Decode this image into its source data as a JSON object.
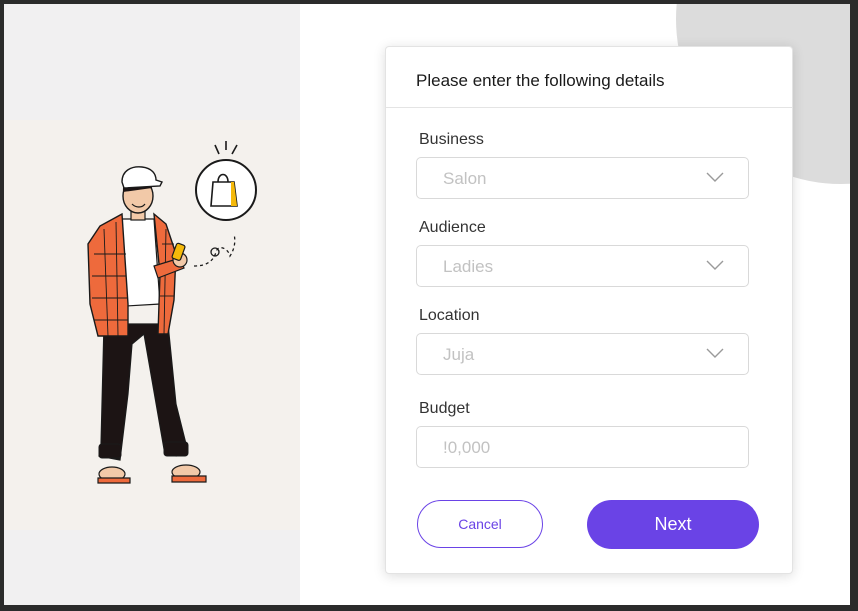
{
  "form": {
    "title": "Please enter the following details",
    "fields": [
      {
        "label": "Business",
        "value": "Salon",
        "type": "dropdown"
      },
      {
        "label": "Audience",
        "value": "Ladies",
        "type": "dropdown"
      },
      {
        "label": "Location",
        "value": "Juja",
        "type": "dropdown"
      },
      {
        "label": "Budget",
        "placeholder": "!0,000",
        "type": "text"
      }
    ],
    "buttons": {
      "cancel_label": "Cancel",
      "next_label": "Next"
    }
  },
  "illustration": {
    "description_icons": [
      "person-icon",
      "smartphone-icon",
      "shopping-bag-icon"
    ]
  },
  "colors": {
    "accent": "#6a43e6",
    "shirt": "#ee6a3c",
    "bag_accent": "#f5b90a"
  }
}
